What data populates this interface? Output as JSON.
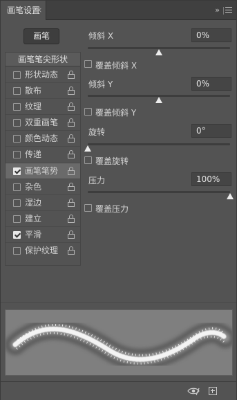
{
  "panel": {
    "tab_title": "画笔设置",
    "close_glyph": "×",
    "collapse_glyph": "»"
  },
  "brush_button": {
    "label": "画笔"
  },
  "list": {
    "header": "画笔笔尖形状",
    "items": [
      {
        "label": "形状动态",
        "checked": false,
        "selected": false
      },
      {
        "label": "散布",
        "checked": false,
        "selected": false
      },
      {
        "label": "纹理",
        "checked": false,
        "selected": false
      },
      {
        "label": "双重画笔",
        "checked": false,
        "selected": false
      },
      {
        "label": "颜色动态",
        "checked": false,
        "selected": false
      },
      {
        "label": "传递",
        "checked": false,
        "selected": false
      },
      {
        "label": "画笔笔势",
        "checked": true,
        "selected": true
      },
      {
        "label": "杂色",
        "checked": false,
        "selected": false
      },
      {
        "label": "湿边",
        "checked": false,
        "selected": false
      },
      {
        "label": "建立",
        "checked": false,
        "selected": false
      },
      {
        "label": "平滑",
        "checked": true,
        "selected": false
      },
      {
        "label": "保护纹理",
        "checked": false,
        "selected": false
      }
    ]
  },
  "settings": {
    "tilt_x": {
      "label": "倾斜 X",
      "value": "0%",
      "level": 0.5
    },
    "override_tilt_x": {
      "label": "覆盖倾斜 X",
      "checked": false
    },
    "tilt_y": {
      "label": "倾斜 Y",
      "value": "0%",
      "level": 0.5
    },
    "override_tilt_y": {
      "label": "覆盖倾斜 Y",
      "checked": false
    },
    "rotation": {
      "label": "旋转",
      "value": "0°",
      "level": 0.0
    },
    "override_rotation": {
      "label": "覆盖旋转",
      "checked": false
    },
    "pressure": {
      "label": "压力",
      "value": "100%",
      "level": 1.0
    },
    "override_pressure": {
      "label": "覆盖压力",
      "checked": false
    }
  },
  "icons": {
    "eye": "eye-icon",
    "new": "new-preset-icon",
    "lock": "lock-icon"
  }
}
